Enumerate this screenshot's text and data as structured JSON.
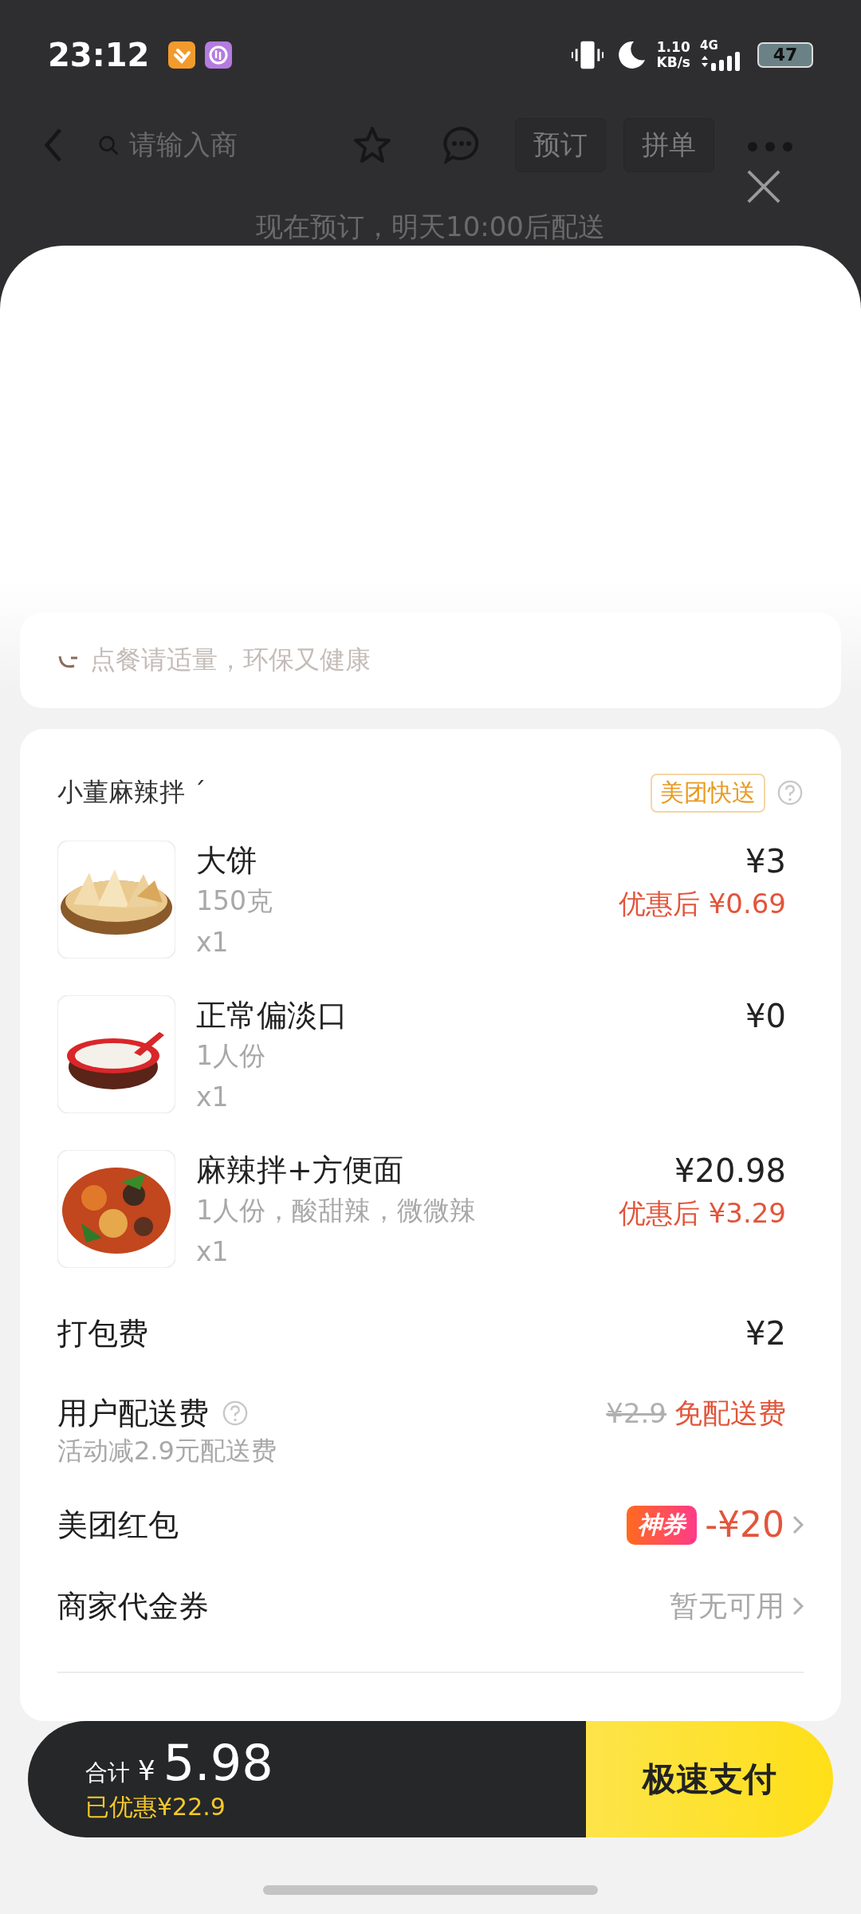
{
  "status_bar": {
    "time": "23:12",
    "net_speed": "1.10",
    "net_unit": "KB/s",
    "network": "4G",
    "battery": "47"
  },
  "header": {
    "search_placeholder": "请输入商",
    "buttons": [
      "预订",
      "拼单"
    ]
  },
  "notice": "现在预订，明天10:00后配送",
  "tip": "点餐请适量，环保又健康",
  "store": {
    "name": "小董麻辣拌 ´",
    "delivery_tag": "美团快送"
  },
  "items": [
    {
      "name": "大饼",
      "spec": "150克",
      "qty": "x1",
      "price": "¥3",
      "discounted": "优惠后 ¥0.69"
    },
    {
      "name": "正常偏淡口",
      "spec": "1人份",
      "qty": "x1",
      "price": "¥0"
    },
    {
      "name": "麻辣拌+方便面",
      "spec": "1人份，酸甜辣，微微辣",
      "qty": "x1",
      "price": "¥20.98",
      "discounted": "优惠后 ¥3.29"
    }
  ],
  "fees": [
    {
      "kind": "plain",
      "label": "打包费",
      "value": "¥2"
    },
    {
      "kind": "delivery",
      "label": "用户配送费",
      "note": "活动减2.9元配送费",
      "original": "¥2.9",
      "value": "免配送费"
    },
    {
      "kind": "coupon",
      "label": "美团红包",
      "badge": "神券",
      "value": "-¥20"
    },
    {
      "kind": "voucher",
      "label": "商家代金券",
      "value": "暂无可用"
    }
  ],
  "bottom": {
    "total_label": "合计",
    "currency": "¥",
    "total": "5.98",
    "saved": "已优惠¥22.9",
    "pay_button": "极速支付"
  }
}
